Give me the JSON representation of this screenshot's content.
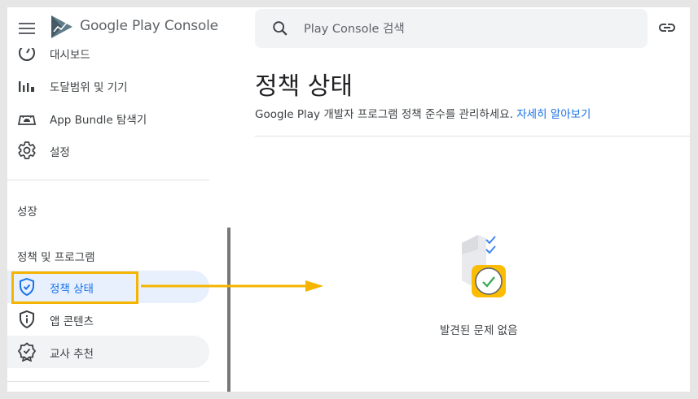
{
  "header": {
    "brand_google_play": "Google Play",
    "brand_console": "Console",
    "search_placeholder": "Play Console 검색"
  },
  "sidebar": {
    "partial_item_label": "대시보드",
    "items": [
      {
        "label": "도달범위 및 기기",
        "icon": "bar-chart-icon"
      },
      {
        "label": "App Bundle 탐색기",
        "icon": "android-bundle-icon"
      },
      {
        "label": "설정",
        "icon": "gear-icon"
      }
    ],
    "section_growth": "성장",
    "section_policy": "정책 및 프로그램",
    "policy_items": [
      {
        "label": "정책 상태",
        "icon": "shield-check-icon",
        "state": "active"
      },
      {
        "label": "앱 콘텐츠",
        "icon": "shield-info-icon"
      },
      {
        "label": "교사 추천",
        "icon": "badge-check-icon",
        "state": "hover"
      }
    ]
  },
  "main": {
    "title": "정책 상태",
    "subtitle": "Google Play 개발자 프로그램 정책 준수를 관리하세요.",
    "learn_more": "자세히 알아보기",
    "empty_state": "발견된 문제 없음"
  },
  "colors": {
    "accent": "#1a73e8",
    "active_bg": "#e8f0fe",
    "annotation": "#f4b400",
    "success": "#34a853"
  }
}
